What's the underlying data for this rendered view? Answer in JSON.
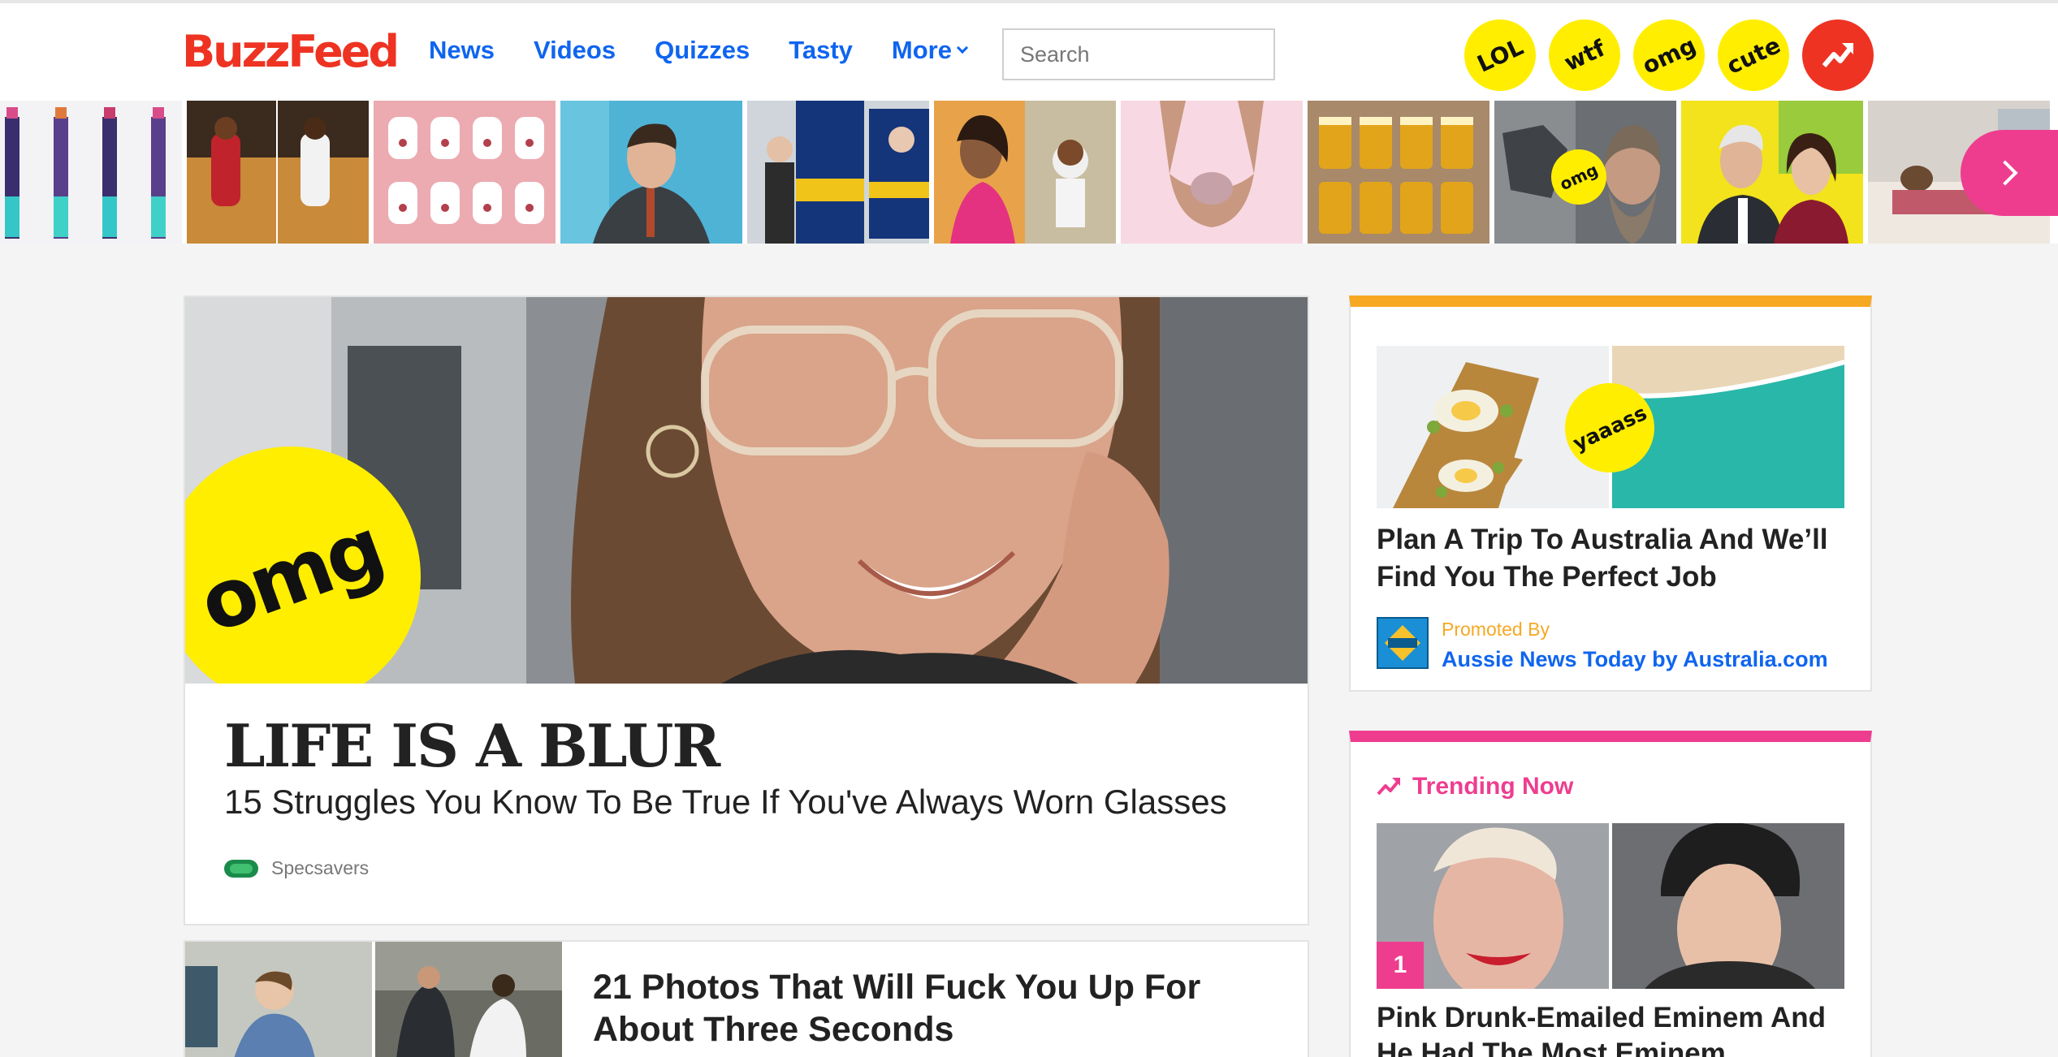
{
  "header": {
    "logo": "BuzzFeed",
    "nav": [
      "News",
      "Videos",
      "Quizzes",
      "Tasty",
      "More"
    ],
    "search_placeholder": "Search",
    "badges": [
      "LOL",
      "wtf",
      "omg",
      "cute"
    ]
  },
  "strip": {
    "omg_badge": "omg"
  },
  "feature": {
    "badge": "omg",
    "title": "LIFE IS A BLUR",
    "subtitle": "15 Struggles You Know To Be True If You've Always Worn Glasses",
    "source": "Specsavers"
  },
  "second_story": {
    "title": "21 Photos That Will Fuck You Up For About Three Seconds"
  },
  "promo": {
    "badge": "yaaass",
    "title": "Plan A Trip To Australia And We’ll Find You The Perfect Job",
    "promoted_label": "Promoted By",
    "brand": "Aussie News Today by Australia.com"
  },
  "trending": {
    "heading": "Trending Now",
    "rank": "1",
    "title": "Pink Drunk-Emailed Eminem And He Had The Most Eminem"
  },
  "colors": {
    "brand_red": "#ee3322",
    "link_blue": "#0f65ef",
    "badge_yellow": "#ffee00",
    "promo_orange": "#f7a823",
    "trending_pink": "#ee3d8f"
  }
}
